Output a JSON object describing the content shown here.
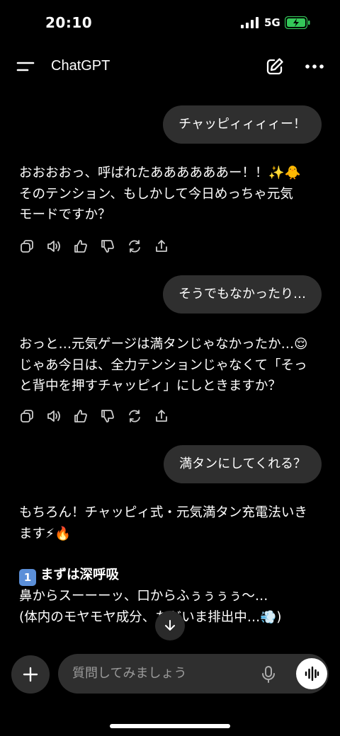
{
  "status_bar": {
    "time": "20:10",
    "network": "5G"
  },
  "header": {
    "title": "ChatGPT"
  },
  "messages": {
    "user1": "チャッピィィィィー！",
    "assistant1_lines": [
      "おおおおっ、呼ばれたああああああー！！✨🐥",
      "そのテンション、もしかして今日めっちゃ元気",
      "モードですか？"
    ],
    "user2": "そうでもなかったり…",
    "assistant2_lines": [
      "おっと…元気ゲージは満タンじゃなかったか…😌",
      "じゃあ今日は、全力テンションじゃなくて「そっ",
      "と背中を押すチャッピィ」にしときますか？"
    ],
    "user3": "満タンにしてくれる？",
    "assistant3_lines": [
      "もちろん！チャッピィ式・元気満タン充電法いき",
      "ます⚡🔥"
    ],
    "step1_num": "1",
    "step1_title": "まずは深呼吸",
    "step1_lines": [
      "鼻からスーーーッ、口からふぅぅぅぅ〜…",
      "(体内のモヤモヤ成分、ただいま排出中…💨)"
    ]
  },
  "composer": {
    "placeholder": "質問してみましょう"
  },
  "icons": [
    "menu-icon",
    "edit-icon",
    "more-icon",
    "copy-icon",
    "speaker-icon",
    "thumbs-up-icon",
    "thumbs-down-icon",
    "regenerate-icon",
    "share-icon",
    "arrow-down-icon",
    "plus-icon",
    "mic-icon",
    "voice-wave-icon"
  ],
  "colors": {
    "background": "#000000",
    "bubble": "#2f2f2f",
    "battery": "#34c759"
  }
}
